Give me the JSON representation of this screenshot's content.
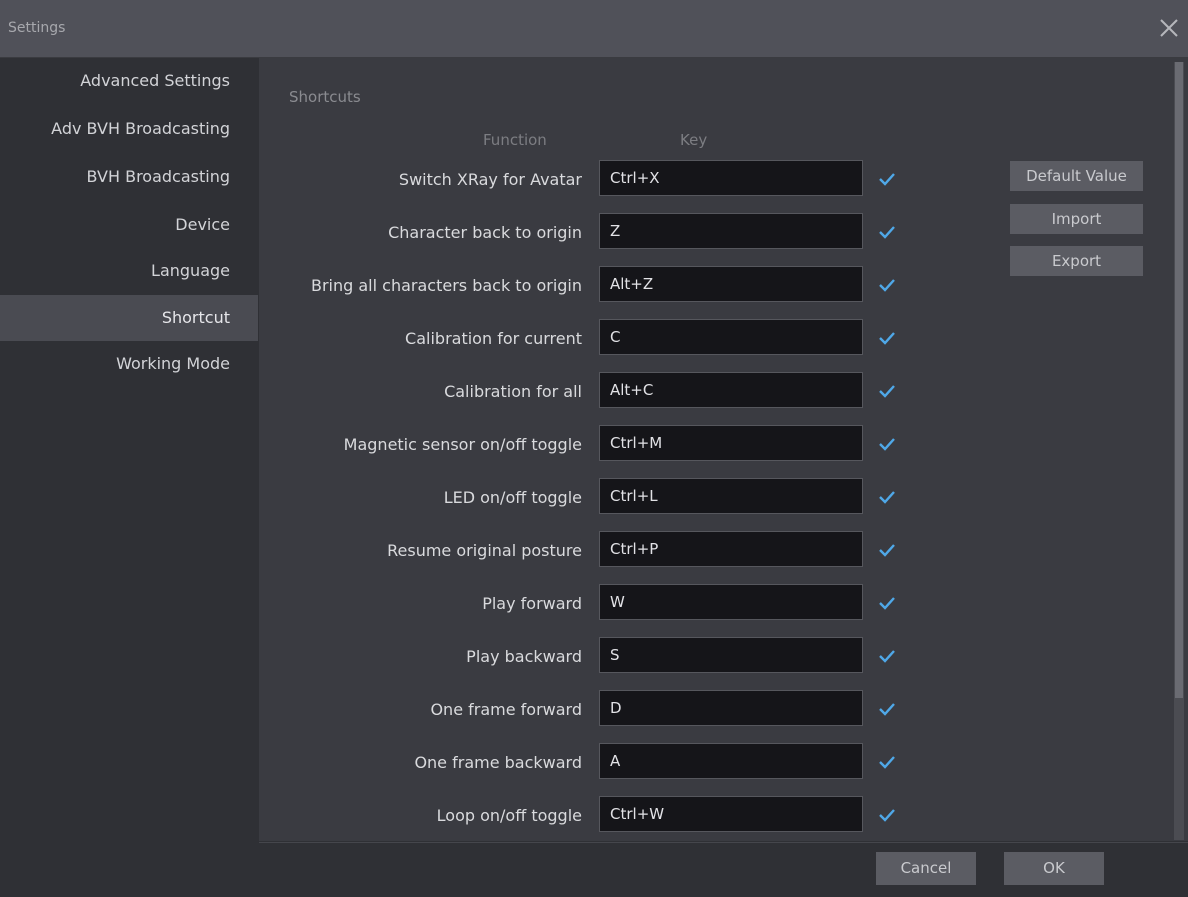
{
  "window": {
    "title": "Settings",
    "close_icon": "close-icon"
  },
  "sidebar": {
    "items": [
      {
        "label": "Advanced Settings"
      },
      {
        "label": "Adv BVH Broadcasting"
      },
      {
        "label": "BVH Broadcasting"
      },
      {
        "label": "Device"
      },
      {
        "label": "Language"
      },
      {
        "label": "Shortcut",
        "active": true
      },
      {
        "label": "Working Mode"
      }
    ]
  },
  "shortcuts": {
    "section_title": "Shortcuts",
    "col_function": "Function",
    "col_key": "Key",
    "rows": [
      {
        "function": "Switch XRay for Avatar",
        "key": "Ctrl+X"
      },
      {
        "function": "Character back to origin",
        "key": "Z"
      },
      {
        "function": "Bring all characters back to origin",
        "key": "Alt+Z"
      },
      {
        "function": "Calibration for current",
        "key": "C"
      },
      {
        "function": "Calibration for all",
        "key": "Alt+C"
      },
      {
        "function": "Magnetic sensor on/off toggle",
        "key": "Ctrl+M"
      },
      {
        "function": "LED on/off toggle",
        "key": "Ctrl+L"
      },
      {
        "function": "Resume original posture",
        "key": "Ctrl+P"
      },
      {
        "function": "Play forward",
        "key": "W"
      },
      {
        "function": "Play backward",
        "key": "S"
      },
      {
        "function": "One frame forward",
        "key": "D"
      },
      {
        "function": "One frame backward",
        "key": "A"
      },
      {
        "function": "Loop on/off toggle",
        "key": "Ctrl+W"
      }
    ],
    "check_icon": "check-icon",
    "default_value_label": "Default Value",
    "import_label": "Import",
    "export_label": "Export"
  },
  "footer": {
    "cancel_label": "Cancel",
    "ok_label": "OK"
  },
  "colors": {
    "accent_check": "#4fa8e8",
    "background": "#2f3035",
    "titlebar": "#505159"
  }
}
